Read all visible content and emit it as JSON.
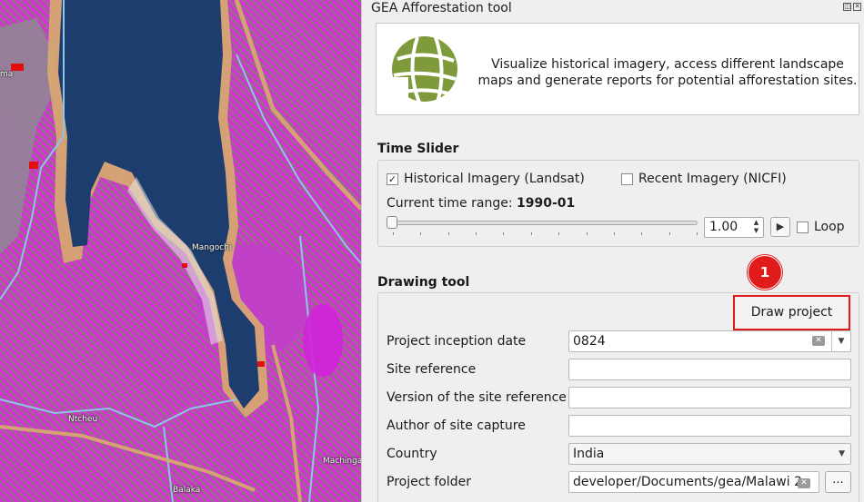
{
  "map": {
    "labels": [
      "Mangochi",
      "Ntcheu",
      "Balaka",
      "Machinga",
      "ma"
    ]
  },
  "dock": {
    "title": "GEA Afforestation tool",
    "header_text": "Visualize historical imagery, access different landscape maps and generate reports for potential afforestation sites."
  },
  "time_slider": {
    "title": "Time Slider",
    "historical_label": "Historical Imagery (Landsat)",
    "historical_checked": true,
    "recent_label": "Recent Imagery (NICFI)",
    "recent_checked": false,
    "range_label": "Current time range: ",
    "range_value": "1990-01",
    "slider_position": 0,
    "speed_value": "1.00",
    "loop_label": "Loop"
  },
  "drawing_tool": {
    "title": "Drawing tool",
    "badge": "1",
    "draw_button": "Draw project area",
    "fields": {
      "inception_label": "Project inception date",
      "inception_value": "0824",
      "site_ref_label": "Site reference",
      "site_ref_value": "",
      "version_label": "Version of the site reference",
      "version_value": "",
      "author_label": "Author of site capture",
      "author_value": "",
      "country_label": "Country",
      "country_value": "India",
      "folder_label": "Project folder",
      "folder_value": "developer/Documents/gea/Malawi 2",
      "browse_label": "..."
    }
  },
  "colors": {
    "accent_red": "#e11b1b",
    "logo_green": "#7f9a3a",
    "map_magenta": "#ff00ff",
    "water": "#1c3d6e",
    "buffer": "#d9b06a"
  }
}
